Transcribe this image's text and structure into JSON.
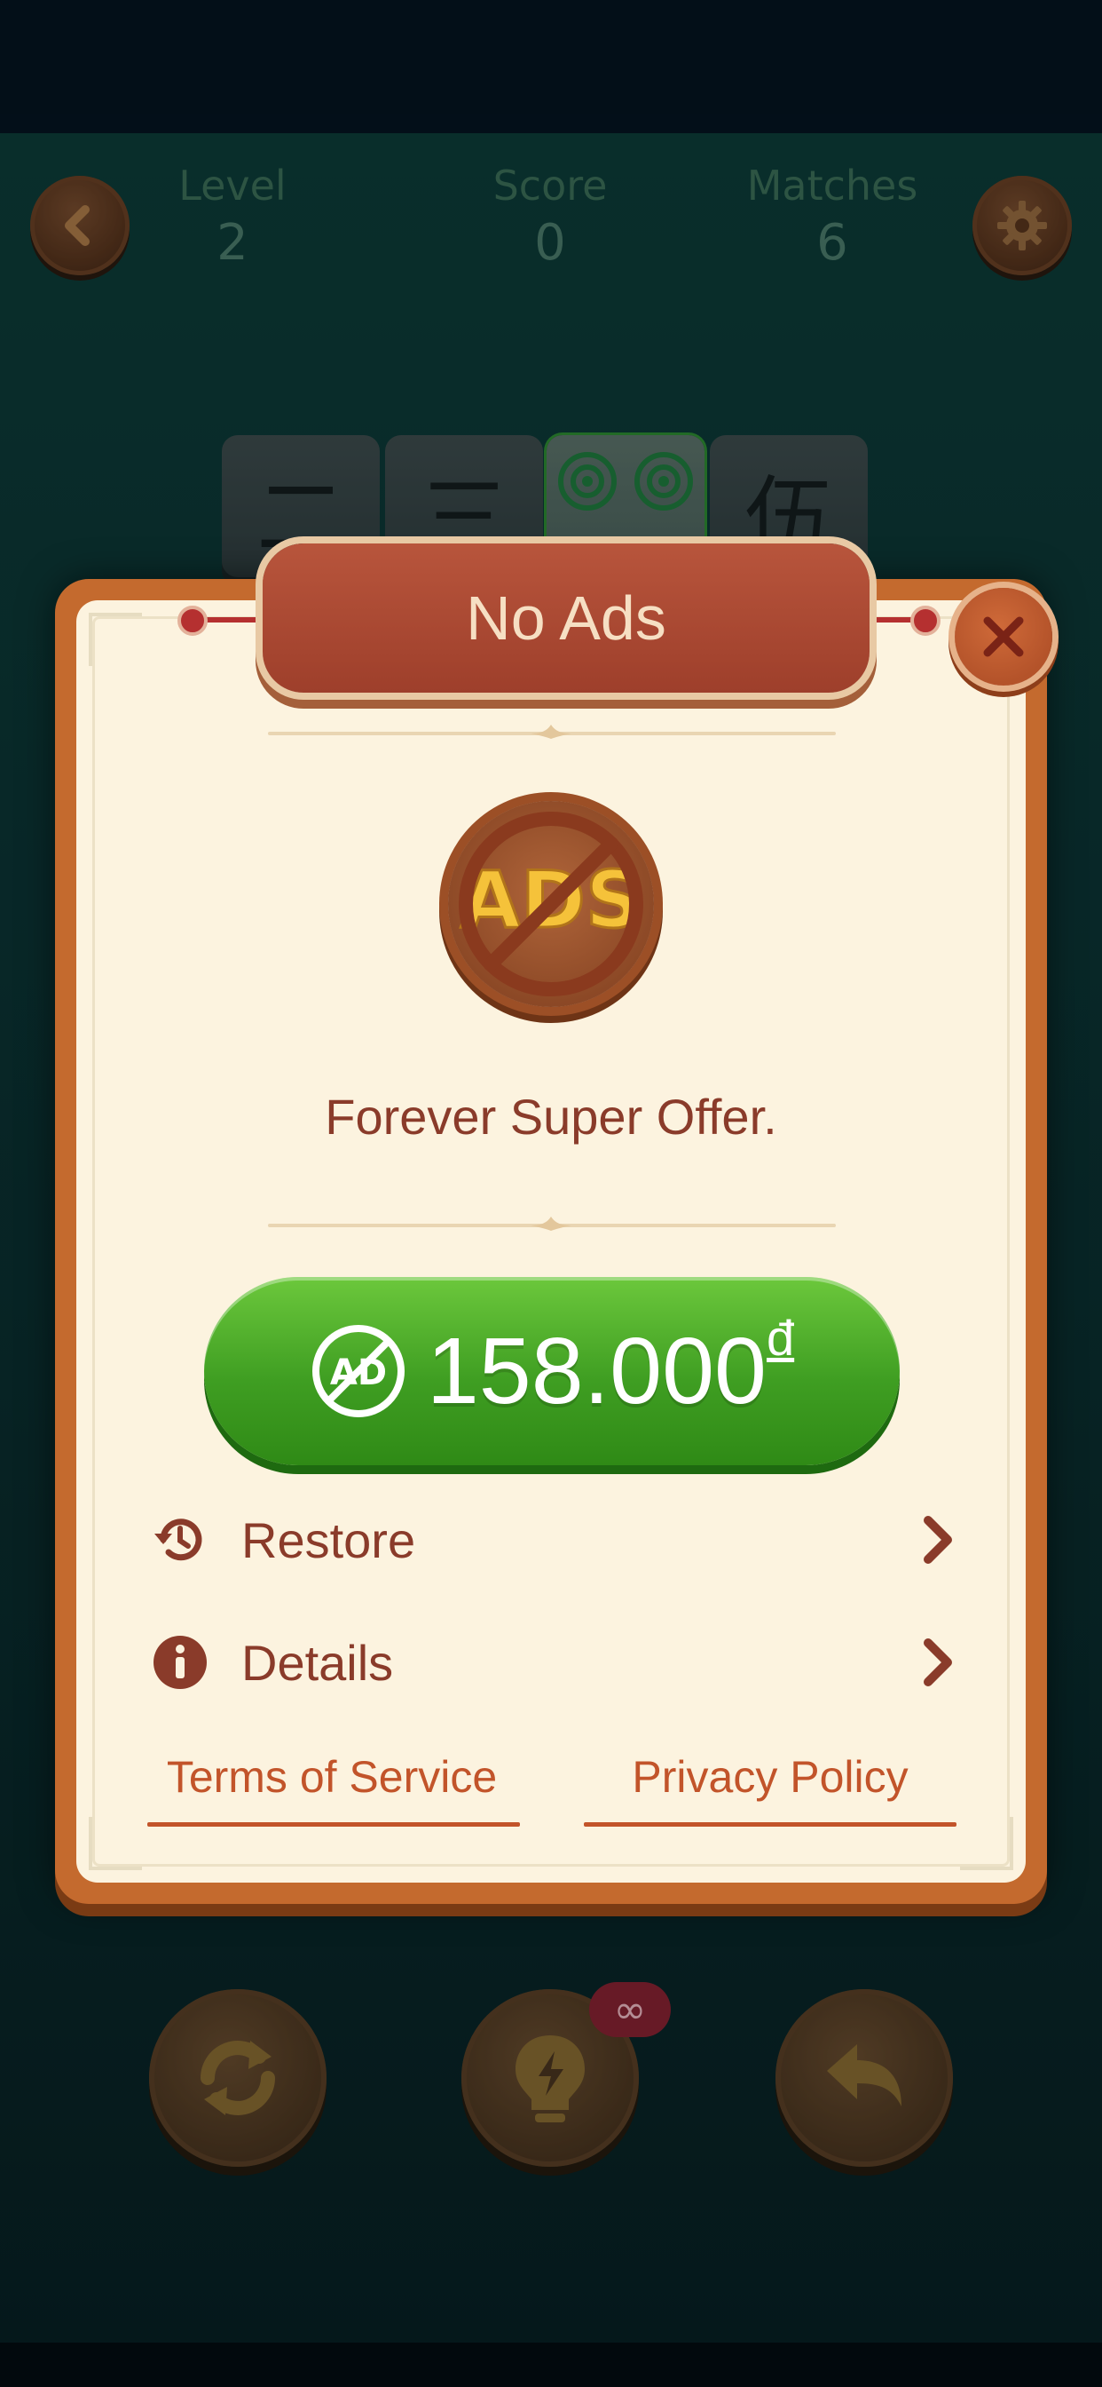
{
  "hud": {
    "level_label": "Level",
    "level_value": "2",
    "score_label": "Score",
    "score_value": "0",
    "matches_label": "Matches",
    "matches_value": "6"
  },
  "board": {
    "tiles": [
      {
        "glyph": "二",
        "icon": "character-two-tile"
      },
      {
        "glyph": "三",
        "icon": "character-three-tile"
      },
      {
        "glyph": "",
        "icon": "two-circles-tile",
        "highlighted": true
      },
      {
        "glyph": "伍",
        "icon": "character-five-tile"
      }
    ]
  },
  "dialog": {
    "title": "No Ads",
    "badge_text": "ADS",
    "subtitle": "Forever Super Offer.",
    "buy_button": {
      "icon": "no-ad-icon",
      "icon_text": "AD",
      "price": "158.000",
      "currency": "đ"
    },
    "rows": [
      {
        "icon": "history-icon",
        "label": "Restore"
      },
      {
        "icon": "info-icon",
        "label": "Details"
      }
    ],
    "links": {
      "terms": "Terms of Service",
      "privacy": "Privacy Policy"
    }
  },
  "controls": {
    "shuffle": "shuffle-icon",
    "hint": "lightbulb-icon",
    "hint_badge": "∞",
    "undo": "undo-icon"
  },
  "colors": {
    "game_bg": "#0d3a34",
    "dialog_border": "#c46a2e",
    "dialog_fill": "#fcf3df",
    "title_plaque": "#9e3f2b",
    "buy_green": "#3f9e22",
    "text_brown": "#8a3b2a",
    "link_orange": "#c2542a"
  }
}
